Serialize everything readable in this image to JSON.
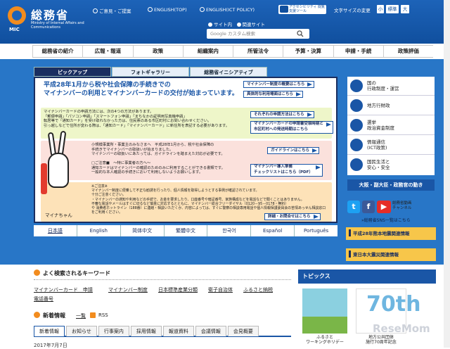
{
  "header": {
    "logo_jp": "総務省",
    "logo_mic": "MIC",
    "logo_en": "Ministry of Internal Affairs and Communications",
    "links": [
      "ご意見・ご提案",
      "ENGLISH(TOP)",
      "ENGLISH(ICT POLICY)"
    ],
    "accessibility": "アクセシビリティ 閲覧支援ツール",
    "font_size_label": "文字サイズの変更",
    "font_sizes": [
      "小",
      "標準",
      "大"
    ],
    "scope_site": "サイト内",
    "scope_related": "関連サイト",
    "search_placeholder": "Google カスタム検索"
  },
  "nav": [
    "総務省の紹介",
    "広報・報道",
    "政策",
    "組織案内",
    "所管法令",
    "予算・決算",
    "申請・手続",
    "政策評価"
  ],
  "pickup": {
    "tabs": [
      "ピックアップ",
      "フォトギャラリー",
      "総務省イニシアティブ"
    ],
    "title": "平成28年1月から税や社会保障の手続きでの\nマイナンバーの利用とマイナンバーカードの交付が始まっています。",
    "pill_overview": "マイナンバー制度の概要はこちら",
    "pill_qa": "具体的な利用場面はこちら",
    "box_card_text": "マイナンバーカードの申請方法には、次の4つの方法があります。\n「郵便申請」「パソコン申請」「スマートフォン申請」「まちなかの証明用写真機申請」\n転居等で「通知カード」を受け取れなかった方は、住民票のある市区町村にお問い合わせください。\n引っ越しなどで住所が変わる際は、「通知カード」「マイナンバーカード」に新住所を表記する必要があります。",
    "pill_apply": "それぞれの申請方法はこちら",
    "pill_status": "マイナンバーカードの申請書受領時期と\n市区町村への発送時期はこちら",
    "box_biz_text": "小規模事業所・事業主のみなさまへ　平成28年1月から、税や社会保障の\n手続きでマイナンバーの取扱いが始まりました。\nマイナンバーの取扱いにあたっては、ガイドラインを踏まえた対応が必要です。\n\n□ご注意■　〜特に事業者の方へ〜\n通知カードはマイナンバーの確認のためのみに利用することができる書類です。\n一般的な本人確認の手続きにおいて利用しないようお願いします。",
    "pill_guide": "ガイドラインはこちら",
    "pill_check": "マイナンバー導入準備\nチェックリストはこちら（PDF）",
    "box_warn_text": "※ご注意※\nマイナンバー制度に便乗して不正な勧誘を行ったり、個人情報を取得しようとする事例が確認されています。\n十分ご注意ください。\n・マイナンバーの通知や利用などの手続で、お金を要求したり、口座番号や暗証番号、家族構成などを電話などで聞くことはありません。\n不審な電話やメールはすぐに切るなど慎重に対応するとともに、マイナンバー総合フリーダイヤル（0120－95－0178・無料）\nや 消費者ホットライン（188番）に連絡・相談いただくか、内容によっては、すぐに警察の相談専用電話や個人情報保護委員会の苦情あっせん相談窓口をご利用ください。",
    "pill_detail": "詳細・お問合せはこちら",
    "mascot_name": "マイナちゃん",
    "languages": [
      "日本語",
      "English",
      "简体中文",
      "繁體中文",
      "한국어",
      "Español",
      "Português"
    ]
  },
  "side": {
    "items": [
      "国の\n行政制度・運営",
      "地方行財政",
      "選挙\n政治資金制度",
      "情報通信\n(ICT政策)",
      "国民生活と\n安心・安全"
    ],
    "miryoku": "大阪・副大臣・政務官の動き",
    "youtube": "総務省動画\nチャンネル",
    "sns": "»総務省SNS一覧はこちら",
    "band1": "平成28年熊本地震関連情報",
    "band2": "東日本大震災関連情報"
  },
  "keywords": {
    "title": "よく検索されるキーワード",
    "items": [
      "マイナンバーカード　申請",
      "マイナンバー制度",
      "日本標準産業分類",
      "衛子自治体",
      "ふるさと納税",
      "電話番号"
    ]
  },
  "news": {
    "title": "新着情報",
    "list_link": "一覧",
    "rss": "RSS",
    "tabs": [
      "新着情報",
      "お知らせ",
      "行事案内",
      "採用情報",
      "報道資料",
      "会議情報",
      "会見概要"
    ],
    "date": "2017年7月7日"
  },
  "topics": {
    "title": "トピックス",
    "item1": "ふるさと\nワーキングホリデー",
    "item2": "地方公共団体\n施行70周年記念",
    "badge": "70th"
  },
  "watermark": "ReseMom"
}
